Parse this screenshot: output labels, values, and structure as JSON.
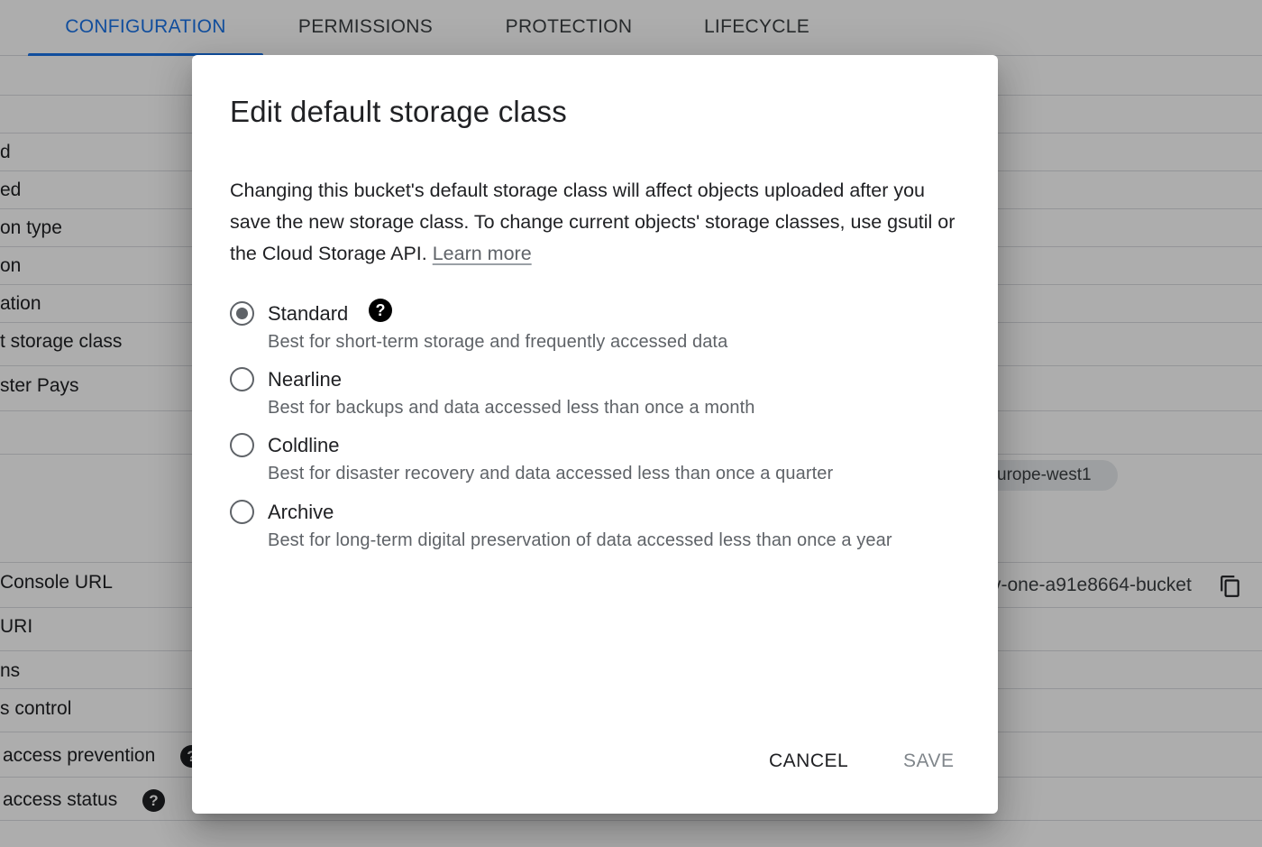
{
  "tabs": [
    {
      "label": "CONFIGURATION",
      "active": true
    },
    {
      "label": "PERMISSIONS",
      "active": false
    },
    {
      "label": "PROTECTION",
      "active": false
    },
    {
      "label": "LIFECYCLE",
      "active": false
    }
  ],
  "background": {
    "labels": [
      "d",
      "ed",
      "on type",
      "on",
      "ation",
      "t storage class",
      "ster Pays",
      "Console URL",
      "URI",
      "ns",
      "s control",
      "access prevention",
      "access status"
    ],
    "region_chip": "urope-west1",
    "bucket_url": "v-one-a91e8664-bucket",
    "help_glyph": "?",
    "icons": {
      "help": "help-icon",
      "copy": "copy-icon"
    }
  },
  "dialog": {
    "title": "Edit default storage class",
    "description": "Changing this bucket's default storage class will affect objects uploaded after you save the new storage class. To change current objects' storage classes, use gsutil or the Cloud Storage API.",
    "learn_more": "Learn more",
    "help_glyph": "?",
    "options": [
      {
        "label": "Standard",
        "description": "Best for short-term storage and frequently accessed data",
        "selected": true
      },
      {
        "label": "Nearline",
        "description": "Best for backups and data accessed less than once a month",
        "selected": false
      },
      {
        "label": "Coldline",
        "description": "Best for disaster recovery and data accessed less than once a quarter",
        "selected": false
      },
      {
        "label": "Archive",
        "description": "Best for long-term digital preservation of data accessed less than once a year",
        "selected": false
      }
    ],
    "cancel_label": "CANCEL",
    "save_label": "SAVE"
  },
  "colors": {
    "accent": "#1a73e8",
    "scrim": "rgba(0,0,0,0.32)",
    "disabled_text": "#80868b"
  }
}
